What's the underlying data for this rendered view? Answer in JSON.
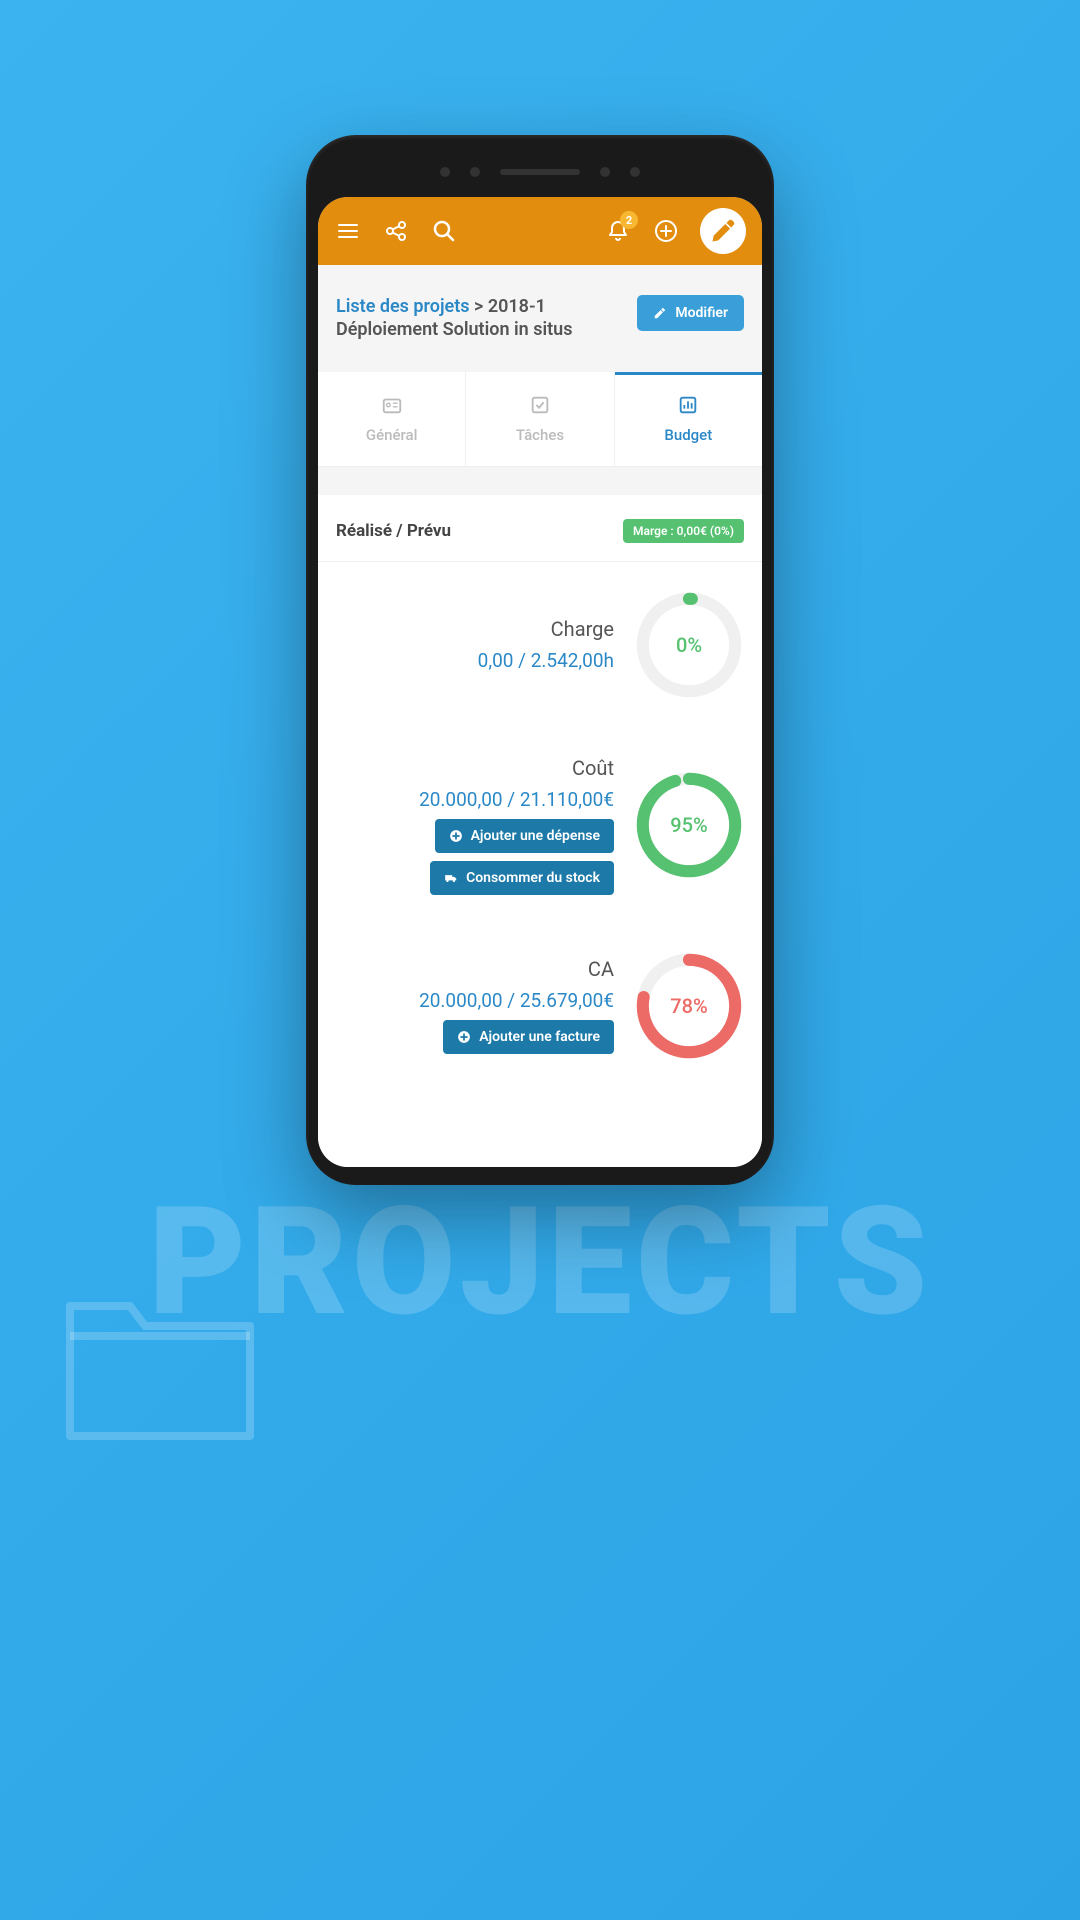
{
  "background": {
    "title": "PROJECTS"
  },
  "header": {
    "notif_count": "2"
  },
  "breadcrumb": {
    "link": "Liste des projets",
    "sep": " > ",
    "current": "2018-1 Déploiement Solution in situs",
    "modify_label": "Modifier"
  },
  "tabs": {
    "general": "Général",
    "tasks": "Tâches",
    "budget": "Budget"
  },
  "section": {
    "title": "Réalisé / Prévu",
    "margin_badge": "Marge : 0,00€ (0%)"
  },
  "metrics": {
    "charge": {
      "label": "Charge",
      "value": "0,00 / 2.542,00h",
      "pct_label": "0%",
      "pct": 0,
      "color": "#56c271"
    },
    "cout": {
      "label": "Coût",
      "value": "20.000,00 / 21.110,00€",
      "pct_label": "95%",
      "pct": 95,
      "color": "#56c271",
      "btn_expense": "Ajouter une dépense",
      "btn_stock": "Consommer du stock"
    },
    "ca": {
      "label": "CA",
      "value": "20.000,00 / 25.679,00€",
      "pct_label": "78%",
      "pct": 78,
      "color": "#ed6b66",
      "btn_invoice": "Ajouter une facture"
    }
  }
}
